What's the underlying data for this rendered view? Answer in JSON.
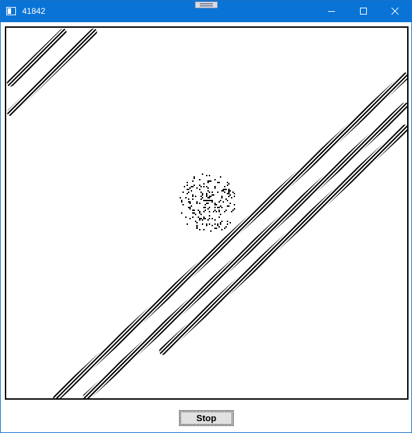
{
  "window": {
    "title": "41842"
  },
  "controls": {
    "stop_label": "Stop"
  },
  "icons": {
    "app": "app-window-icon",
    "minimize": "minimize-icon",
    "maximize": "maximize-icon",
    "close": "close-icon",
    "drag": "drag-handle-icon"
  },
  "colors": {
    "titlebar": "#0a74d6",
    "cells": "#000000",
    "background": "#ffffff"
  }
}
